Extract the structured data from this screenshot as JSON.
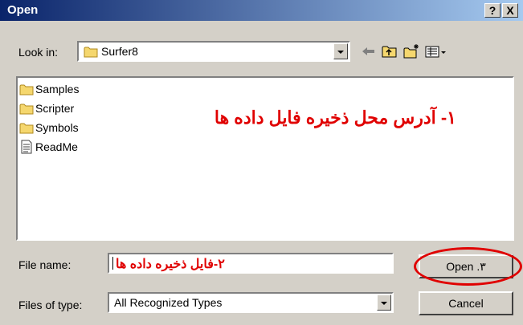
{
  "window": {
    "title": "Open",
    "help_btn": "?",
    "close_btn": "X"
  },
  "look_in": {
    "label": "Look in:",
    "value": "Surfer8"
  },
  "toolbar": {
    "icons": [
      "back-icon",
      "up-folder-icon",
      "new-folder-icon",
      "view-menu-icon"
    ]
  },
  "files": [
    {
      "name": "Samples",
      "type": "folder"
    },
    {
      "name": "Scripter",
      "type": "folder"
    },
    {
      "name": "Symbols",
      "type": "folder"
    },
    {
      "name": "ReadMe",
      "type": "file"
    }
  ],
  "annotations": {
    "location": "۱- آدرس محل ذخیره فایل داده ها",
    "filename": "۲-فایل ذخیره داده ها"
  },
  "file_name": {
    "label": "File name:"
  },
  "file_type": {
    "label": "Files of type:",
    "value": "All Recognized Types"
  },
  "buttons": {
    "open": "Open .۳",
    "cancel": "Cancel"
  },
  "colors": {
    "annotation_red": "#e00000",
    "titlebar": "#0a246a"
  }
}
